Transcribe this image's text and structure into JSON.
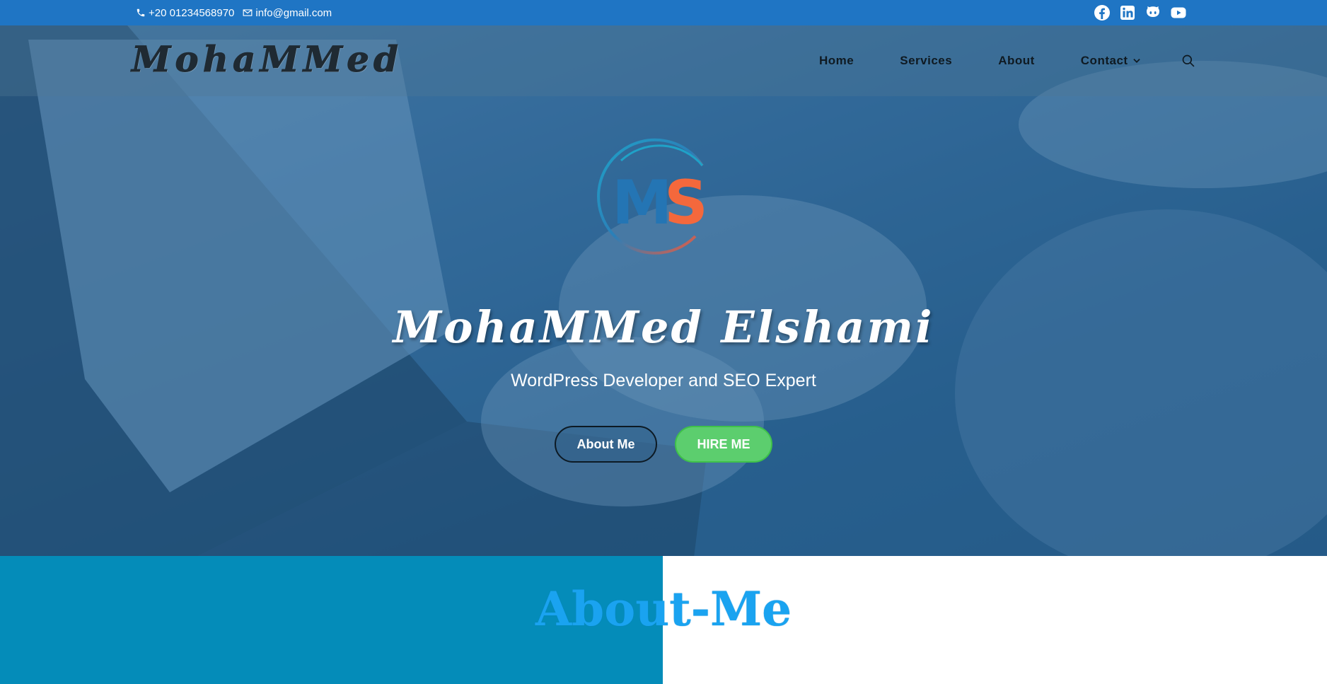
{
  "topbar": {
    "phone_icon": "phone-icon",
    "phone": "+20 01234568970",
    "email_icon": "envelope-icon",
    "email": "info@gmail.com",
    "social": [
      "facebook-icon",
      "linkedin-icon",
      "github-icon",
      "youtube-icon"
    ],
    "bg_color": "#1f75c4"
  },
  "nav": {
    "brand": "MohaMMed",
    "items": [
      {
        "label": "Home"
      },
      {
        "label": "Services"
      },
      {
        "label": "About"
      },
      {
        "label": "Contact",
        "has_dropdown": true
      }
    ],
    "search_icon": "search-icon"
  },
  "hero": {
    "logo_text": "MS",
    "name": "MohaMMed Elshami",
    "subtitle": "WordPress Developer and SEO Expert",
    "buttons": {
      "about": "About Me",
      "hire": "HIRE ME"
    },
    "hire_color": "#5cce6e"
  },
  "about": {
    "title": "About-Me",
    "left_bg": "#048cb9",
    "title_color": "#1aa3f0"
  }
}
